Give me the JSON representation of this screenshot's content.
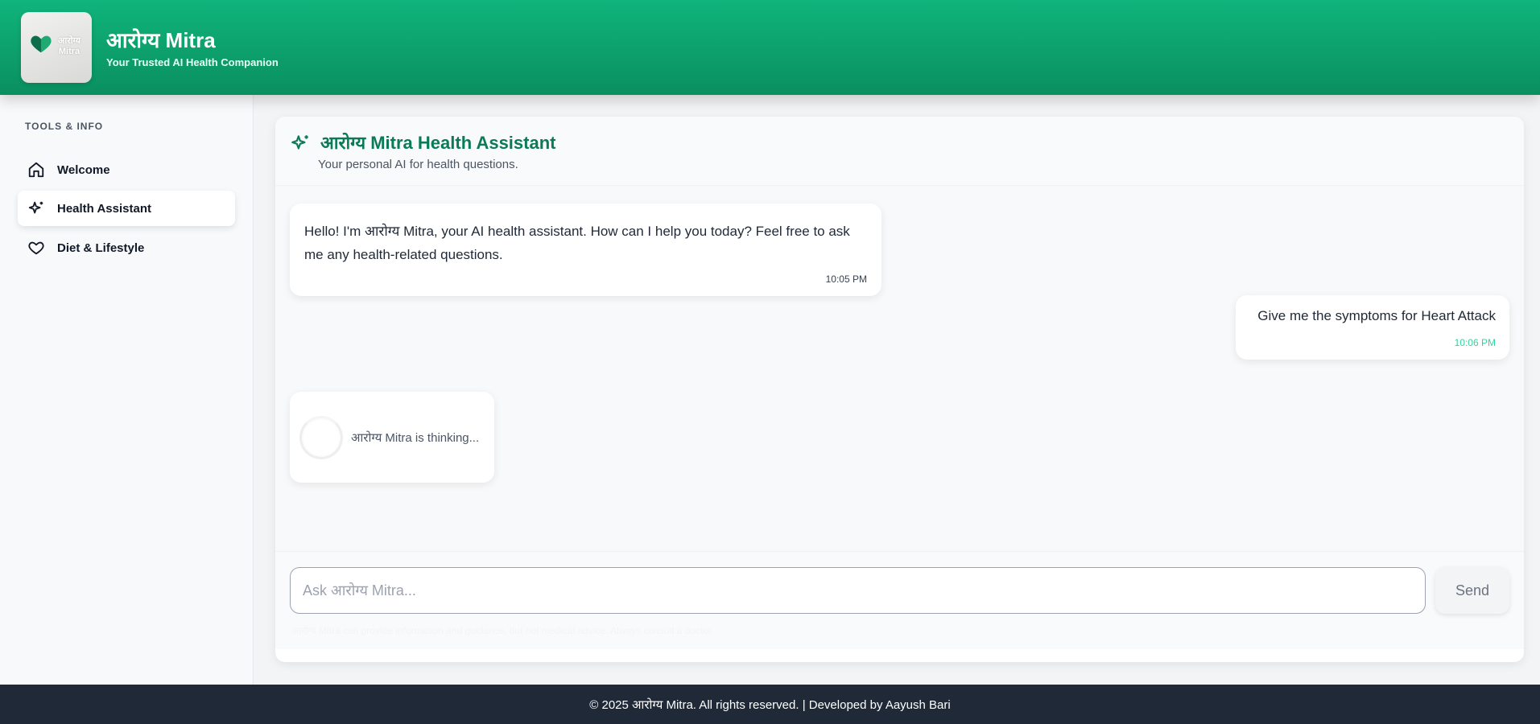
{
  "header": {
    "logo_text": "आरोग्य Mitra",
    "title": "आरोग्य Mitra",
    "tagline": "Your Trusted AI Health Companion"
  },
  "sidebar": {
    "heading": "TOOLS & INFO",
    "items": [
      {
        "label": "Welcome",
        "icon": "home-icon",
        "active": false
      },
      {
        "label": "Health Assistant",
        "icon": "sparkle-icon",
        "active": true
      },
      {
        "label": "Diet & Lifestyle",
        "icon": "heart-icon",
        "active": false
      }
    ]
  },
  "assistant": {
    "title": "आरोग्य Mitra Health Assistant",
    "subtitle": "Your personal AI for health questions.",
    "icon": "sparkle-icon"
  },
  "messages": [
    {
      "role": "assistant",
      "text": "Hello! I'm आरोग्य Mitra, your AI health assistant. How can I help you today? Feel free to ask me any health-related questions.",
      "time": "10:05 PM"
    },
    {
      "role": "user",
      "text": "Give me the symptoms for Heart Attack",
      "time": "10:06 PM"
    }
  ],
  "thinking": {
    "text": "आरोग्य Mitra is thinking..."
  },
  "composer": {
    "placeholder": "Ask आरोग्य Mitra...",
    "value": "",
    "send_label": "Send",
    "disclaimer": "आरोग्य Mitra can provide information and guidance, but not medical advice. Always consult a doctor."
  },
  "footer": {
    "text": "© 2025 आरोग्य Mitra. All rights reserved. | Developed by Aayush Bari"
  },
  "colors": {
    "brand": "#10b47c",
    "brand_dark": "#0a8f60",
    "title_green": "#0b7a55",
    "footer_bg": "#1f2937",
    "user_time": "#34d399"
  }
}
